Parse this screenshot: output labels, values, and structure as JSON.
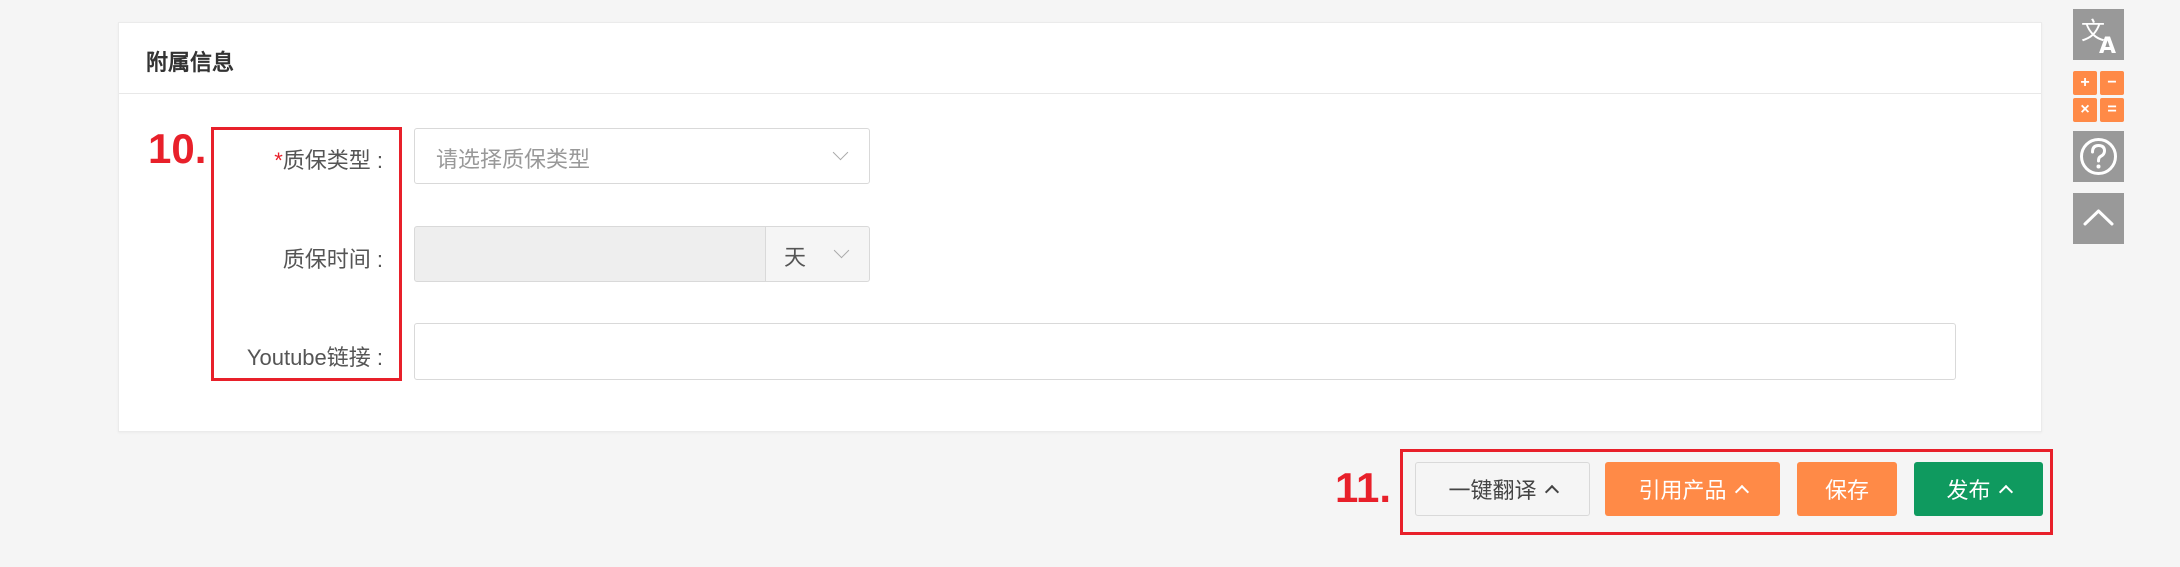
{
  "card": {
    "title": "附属信息"
  },
  "annotations": {
    "form_marker": "10.",
    "buttons_marker": "11.",
    "color": "#e8202a"
  },
  "form": {
    "warranty_type": {
      "required_mark": "*",
      "label": "质保类型 :",
      "placeholder": "请选择质保类型"
    },
    "warranty_time": {
      "label": "质保时间 :",
      "value": "",
      "unit": "天"
    },
    "youtube": {
      "label": "Youtube链接 :",
      "value": ""
    }
  },
  "actions": {
    "translate_label": "一键翻译",
    "reference_label": "引用产品",
    "save_label": "保存",
    "publish_label": "发布"
  },
  "colors": {
    "orange": "#ff8a47",
    "green": "#0f9a5f",
    "grey_tool": "#999999"
  },
  "tools": {
    "icons": [
      "translate-icon",
      "calculator-icon",
      "help-icon",
      "back-to-top-icon"
    ],
    "calc_symbols": [
      "+",
      "−",
      "×",
      "="
    ]
  }
}
